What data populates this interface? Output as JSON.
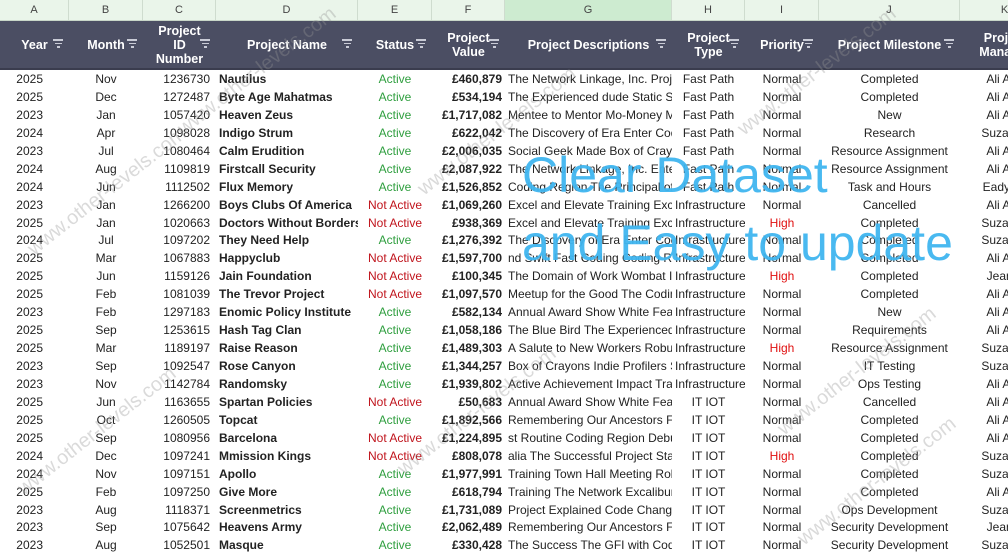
{
  "column_letters": [
    "A",
    "B",
    "C",
    "D",
    "E",
    "F",
    "G",
    "H",
    "I",
    "J",
    "K"
  ],
  "selected_column": "G",
  "headers": [
    "Year",
    "Month",
    "Project\nID\nNumber",
    "Project Name",
    "Status",
    "Project\nValue",
    "Project Descriptions",
    "Project\nType",
    "Priority",
    "Project Milestone",
    "Project\nManager"
  ],
  "overlay": {
    "line1": "Clear Dataset",
    "line2": "and Easy to update"
  },
  "watermark": "www.other-levels.com",
  "colors": {
    "header_bg": "#4b4e63",
    "active": "#2e9e3e",
    "not_active": "#c0141c",
    "high": "#e01010",
    "overlay": "#40b6f0"
  },
  "rows": [
    [
      "2025",
      "Nov",
      "1236730",
      "Nautilus",
      "Active",
      "£460,879",
      "The Network Linkage, Inc. Proje",
      "Fast Path",
      "Normal",
      "Completed",
      "Ali Ada"
    ],
    [
      "2025",
      "Dec",
      "1272487",
      "Byte Age Mahatmas",
      "Active",
      "£534,194",
      "The Experienced dude Static Sta",
      "Fast Path",
      "Normal",
      "Completed",
      "Ali Ada"
    ],
    [
      "2023",
      "Jan",
      "1057420",
      "Heaven Zeus",
      "Active",
      "£1,717,082",
      "Mentee to Mentor Mo-Money Ma",
      "Fast Path",
      "Normal",
      "New",
      "Ali Ada"
    ],
    [
      "2024",
      "Apr",
      "1098028",
      "Indigo Strum",
      "Active",
      "£622,042",
      "The Discovery of Era Enter Codi",
      "Fast Path",
      "Normal",
      "Research",
      "Suzan M"
    ],
    [
      "2023",
      "Jul",
      "1080464",
      "Calm Erudition",
      "Active",
      "£2,006,035",
      "Social Geek Made Box of Crayo",
      "Fast Path",
      "Normal",
      "Resource Assignment",
      "Ali Ada"
    ],
    [
      "2024",
      "Aug",
      "1109819",
      "Firstcall Security",
      "Active",
      "£2,087,922",
      "The Network Linkage, Inc. Enter",
      "Fast Path",
      "Normal",
      "Resource Assignment",
      "Ali Ada"
    ],
    [
      "2024",
      "Jun",
      "1112502",
      "Flux Memory",
      "Active",
      "£1,526,852",
      "Coding Region The Principal of",
      "Fast Path",
      "Normal",
      "Task and Hours",
      "Eady Ve"
    ],
    [
      "2023",
      "Jan",
      "1266200",
      "Boys Clubs Of America",
      "Not Active",
      "£1,069,260",
      "Excel and Elevate Training Exca",
      "Infrastructure",
      "Normal",
      "Cancelled",
      "Ali Ada"
    ],
    [
      "2025",
      "Jan",
      "1020663",
      "Doctors Without Borders",
      "Not Active",
      "£938,369",
      "Excel and Elevate Training Exca",
      "Infrastructure",
      "High",
      "Completed",
      "Suzan M"
    ],
    [
      "2024",
      "Jul",
      "1097202",
      "They Need Help",
      "Active",
      "£1,276,392",
      "The Discovery of Era Enter Codi",
      "Infrastructure",
      "Normal",
      "Completed",
      "Suzan M"
    ],
    [
      "2025",
      "Mar",
      "1067883",
      "Happyclub",
      "Not Active",
      "£1,597,700",
      "nd Swift Fast Coding Coding Reg",
      "Infrastructure",
      "Normal",
      "Completed",
      "Ali Ada"
    ],
    [
      "2025",
      "Jun",
      "1159126",
      "Jain Foundation",
      "Not Active",
      "£100,345",
      "The Domain of Work Wombat In",
      "Infrastructure",
      "High",
      "Completed",
      "Jean Z"
    ],
    [
      "2025",
      "Feb",
      "1081039",
      "The Trevor Project",
      "Not Active",
      "£1,097,570",
      "Meetup for the Good The Coding",
      "Infrastructure",
      "Normal",
      "Completed",
      "Ali Ada"
    ],
    [
      "2023",
      "Feb",
      "1297183",
      "Enomic Policy Institute",
      "Active",
      "£582,134",
      "Annual Award Show White Featl",
      "Infrastructure",
      "Normal",
      "New",
      "Ali Ada"
    ],
    [
      "2025",
      "Sep",
      "1253615",
      "Hash Tag Clan",
      "Active",
      "£1,058,186",
      "The Blue Bird The Experienced",
      "Infrastructure",
      "Normal",
      "Requirements",
      "Ali Ada"
    ],
    [
      "2025",
      "Mar",
      "1189197",
      "Raise Reason",
      "Active",
      "£1,489,303",
      "A Salute to New Workers Robus",
      "Infrastructure",
      "High",
      "Resource Assignment",
      "Suzan M"
    ],
    [
      "2023",
      "Sep",
      "1092547",
      "Rose Canyon",
      "Active",
      "£1,344,257",
      "Box of Crayons Indie Profilers S",
      "Infrastructure",
      "Normal",
      "IT Testing",
      "Suzan M"
    ],
    [
      "2023",
      "Nov",
      "1142784",
      "Randomsky",
      "Active",
      "£1,939,802",
      "Active Achievement Impact Trair",
      "Infrastructure",
      "Normal",
      "Ops Testing",
      "Ali Ada"
    ],
    [
      "2025",
      "Jun",
      "1163655",
      "Spartan Policies",
      "Not Active",
      "£50,683",
      "Annual Award Show White Featl",
      "IT IOT",
      "Normal",
      "Cancelled",
      "Ali Ada"
    ],
    [
      "2025",
      "Oct",
      "1260505",
      "Topcat",
      "Active",
      "£1,892,566",
      "Remembering Our Ancestors Fa",
      "IT IOT",
      "Normal",
      "Completed",
      "Ali Ada"
    ],
    [
      "2025",
      "Sep",
      "1080956",
      "Barcelona",
      "Not Active",
      "£1,224,895",
      "st Routine Coding Region Debug",
      "IT IOT",
      "Normal",
      "Completed",
      "Ali Ada"
    ],
    [
      "2024",
      "Dec",
      "1097241",
      "Mmission Kings",
      "Not Active",
      "£808,078",
      "alia The Successful Project Static",
      "IT IOT",
      "High",
      "Completed",
      "Suzan M"
    ],
    [
      "2024",
      "Nov",
      "1097151",
      "Apollo",
      "Active",
      "£1,977,991",
      "Training Town Hall Meeting Robu",
      "IT IOT",
      "Normal",
      "Completed",
      "Suzan M"
    ],
    [
      "2025",
      "Feb",
      "1097250",
      "Give More",
      "Active",
      "£618,794",
      "Training The Network Excalibur T",
      "IT IOT",
      "Normal",
      "Completed",
      "Ali Ada"
    ],
    [
      "2023",
      "Aug",
      "1118371",
      "Screenmetrics",
      "Active",
      "£1,731,089",
      "Project Explained Code Change",
      "IT IOT",
      "Normal",
      "Ops Development",
      "Suzan M"
    ],
    [
      "2023",
      "Sep",
      "1075642",
      "Heavens Army",
      "Active",
      "£2,062,489",
      "Remembering Our Ancestors Fa",
      "IT IOT",
      "Normal",
      "Security Development",
      "Jean Z"
    ],
    [
      "2023",
      "Aug",
      "1052501",
      "Masque",
      "Active",
      "£330,428",
      "The Success The GFI with Code",
      "IT IOT",
      "Normal",
      "Security Development",
      "Suzan M"
    ]
  ]
}
